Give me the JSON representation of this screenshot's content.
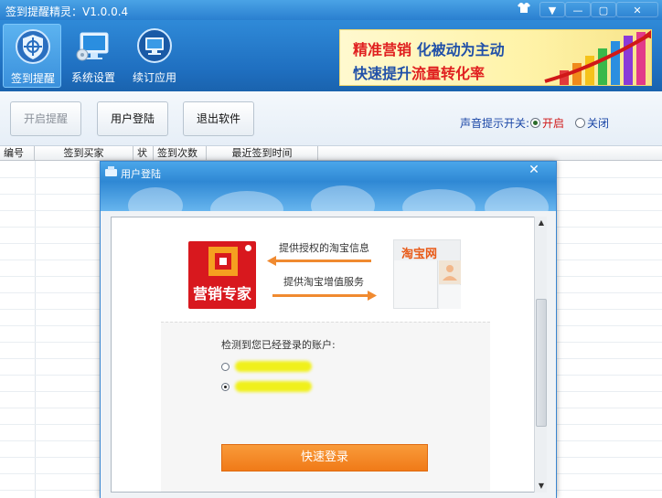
{
  "app": {
    "title": "签到提醒精灵：V1.0.0.4"
  },
  "toolbar": {
    "items": [
      {
        "label": "签到提醒"
      },
      {
        "label": "系统设置"
      },
      {
        "label": "续订应用"
      }
    ]
  },
  "banner": {
    "line1_a": "精准营销",
    "line1_b": "化被动为主动",
    "line2_a": "快速提升",
    "line2_b": "流量转化率"
  },
  "actions": {
    "start_remind": "开启提醒",
    "user_login": "用户登陆",
    "exit_app": "退出软件"
  },
  "sound": {
    "label": "声音提示开关:",
    "on": "开启",
    "off": "关闭",
    "selected": "开启"
  },
  "table": {
    "columns": [
      "编号",
      "签到买家",
      "状",
      "签到次数",
      "最近签到时间"
    ]
  },
  "dialog": {
    "title": "用户登陆",
    "arrow1": "提供授权的淘宝信息",
    "arrow2": "提供淘宝增值服务",
    "logo_text": "营销专家",
    "taobao": "淘宝网",
    "detected": "检测到您已经登录的账户:",
    "login_button": "快速登录"
  },
  "colors": {
    "title_bar": "#2a7fcf",
    "toolbar": "#1f6fc0",
    "accent_orange": "#f07a18",
    "logo_red": "#d8181e",
    "on_red": "#d01818"
  }
}
